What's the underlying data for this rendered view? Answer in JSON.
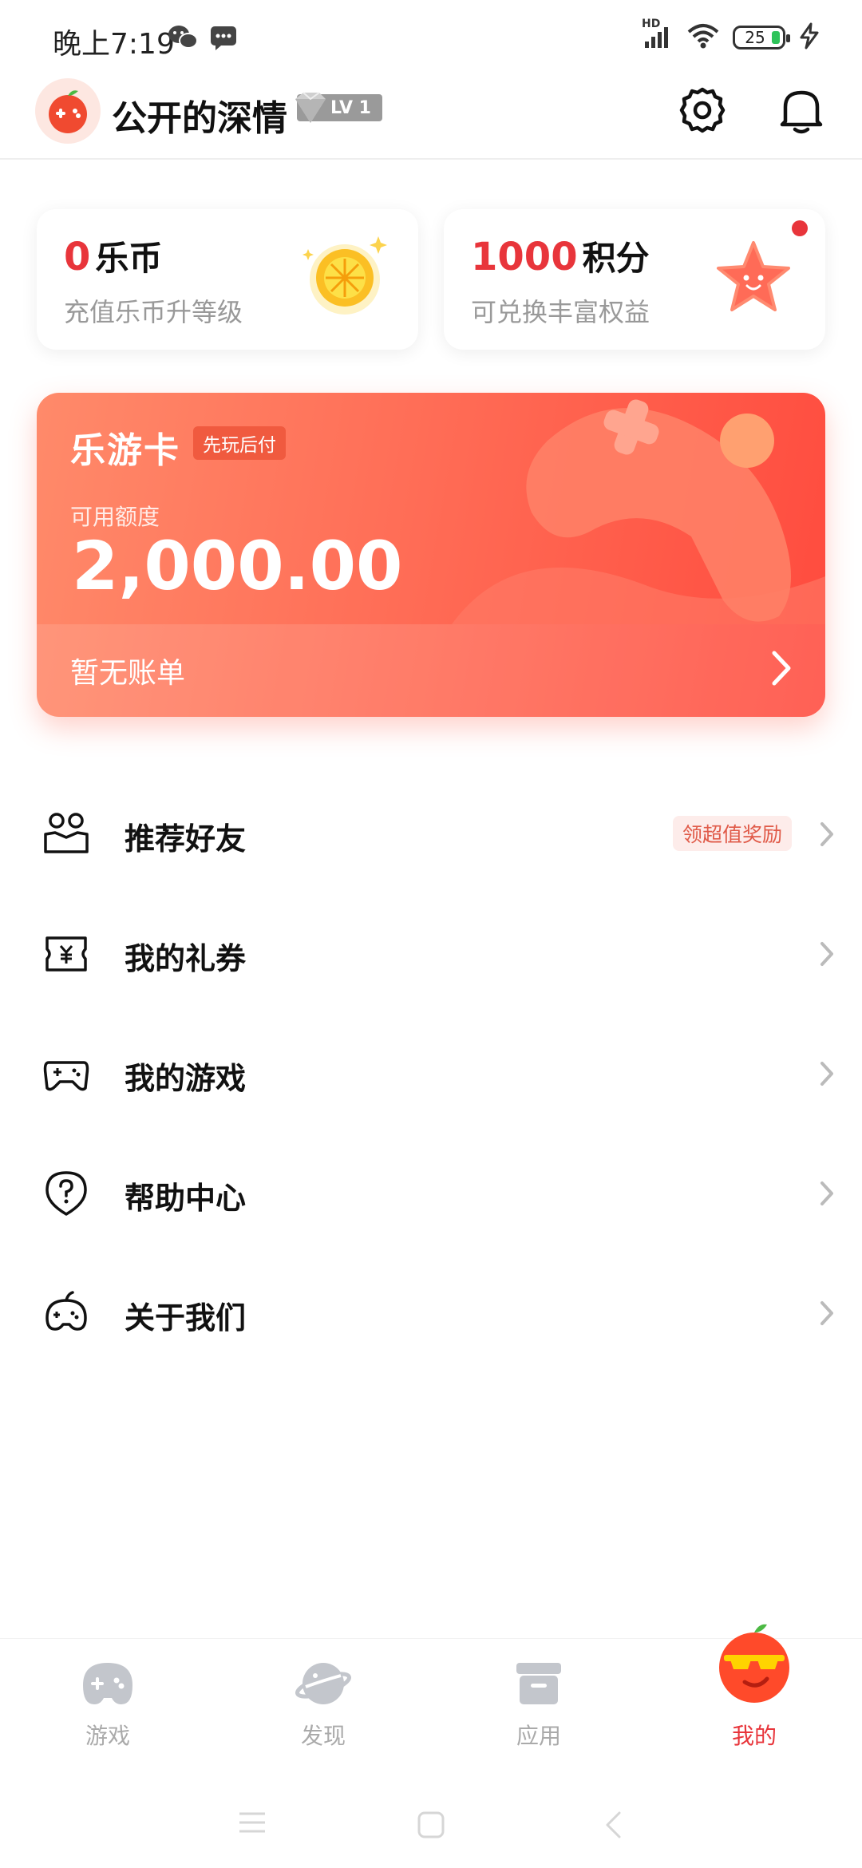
{
  "status_bar": {
    "time": "晚上7:19",
    "network": "HD",
    "battery": "25"
  },
  "header": {
    "username": "公开的深情",
    "level": "LV 1",
    "settings_icon": "gear-icon",
    "notification_icon": "bell-icon"
  },
  "cards": {
    "coins": {
      "value": "0",
      "unit": "乐币",
      "subtitle": "充值乐币升等级"
    },
    "points": {
      "value": "1000",
      "unit": "积分",
      "subtitle": "可兑换丰富权益"
    }
  },
  "play_card": {
    "title": "乐游卡",
    "tag": "先玩后付",
    "available_label": "可用额度",
    "amount": "2,000.00",
    "bill_status": "暂无账单"
  },
  "menu": {
    "items": [
      {
        "label": "推荐好友",
        "icon": "friends-icon",
        "tag": "领超值奖励"
      },
      {
        "label": "我的礼券",
        "icon": "coupon-icon"
      },
      {
        "label": "我的游戏",
        "icon": "gamepad-icon"
      },
      {
        "label": "帮助中心",
        "icon": "help-icon"
      },
      {
        "label": "关于我们",
        "icon": "about-icon"
      }
    ]
  },
  "bottom_nav": {
    "items": [
      {
        "label": "游戏",
        "icon": "game-icon"
      },
      {
        "label": "发现",
        "icon": "planet-icon"
      },
      {
        "label": "应用",
        "icon": "box-icon"
      },
      {
        "label": "我的",
        "icon": "mascot-icon",
        "active": true
      }
    ]
  },
  "colors": {
    "accent": "#e8353b",
    "card_gradient_start": "#ff8a6a",
    "card_gradient_end": "#ff4b3e"
  }
}
